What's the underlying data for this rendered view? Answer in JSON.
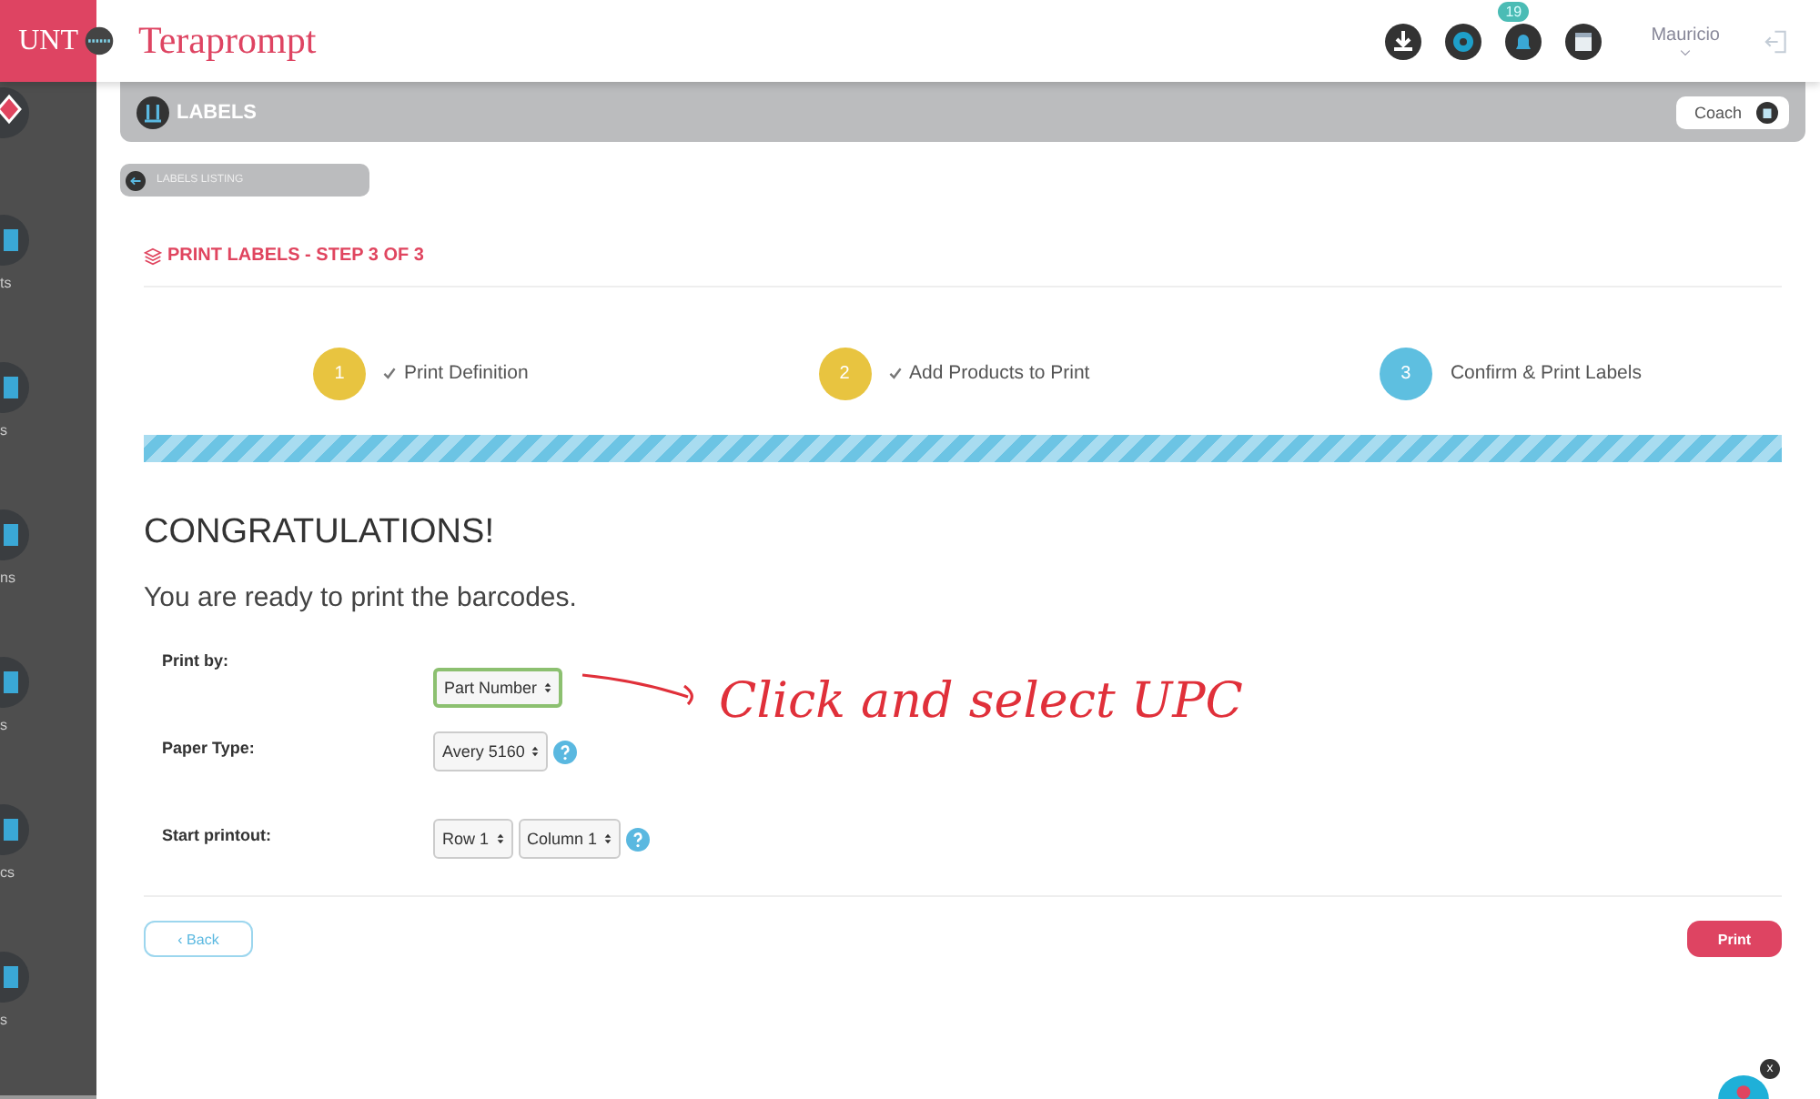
{
  "topbar": {
    "brand_fragment": "UNT",
    "app_name": "Teraprompt",
    "notification_count": "19",
    "user_name": "Mauricio"
  },
  "sidebar": {
    "items": [
      {
        "kind": "diamond"
      },
      {
        "kind": "nav",
        "label": "ts"
      },
      {
        "kind": "nav",
        "label": "s"
      },
      {
        "kind": "nav",
        "label": "ns"
      },
      {
        "kind": "nav",
        "label": "s"
      },
      {
        "kind": "nav",
        "label": "cs"
      },
      {
        "kind": "nav",
        "label": "s"
      }
    ]
  },
  "header": {
    "title": "LABELS",
    "coach_button": "Coach"
  },
  "breadcrumb": "LABELS LISTING",
  "page_title": "PRINT LABELS - STEP 3 OF 3",
  "steps": [
    {
      "number": "1",
      "label": "Print Definition",
      "done": true,
      "selected": false
    },
    {
      "number": "2",
      "label": "Add Products to Print",
      "done": true,
      "selected": false
    },
    {
      "number": "3",
      "label": "Confirm & Print Labels",
      "done": false,
      "selected": true
    }
  ],
  "progress": {
    "level": 1
  },
  "heading": "CONGRATULATIONS!",
  "subheading": "You are ready to print the barcodes.",
  "form": [
    {
      "label": "Print by:",
      "selects": [
        {
          "value": "Part Number",
          "highlighted": true
        }
      ],
      "help": false
    },
    {
      "label": "Paper Type:",
      "selects": [
        {
          "value": "Avery 5160",
          "highlighted": false
        }
      ],
      "help": true
    },
    {
      "label": "Start printout:",
      "selects": [
        {
          "value": "Row 1",
          "highlighted": false
        },
        {
          "value": "Column 1",
          "highlighted": false
        }
      ],
      "help": true
    }
  ],
  "annotation": "Click and select UPC",
  "buttons": {
    "back": "‹ Back",
    "print": "Print"
  },
  "chat_close": "x"
}
